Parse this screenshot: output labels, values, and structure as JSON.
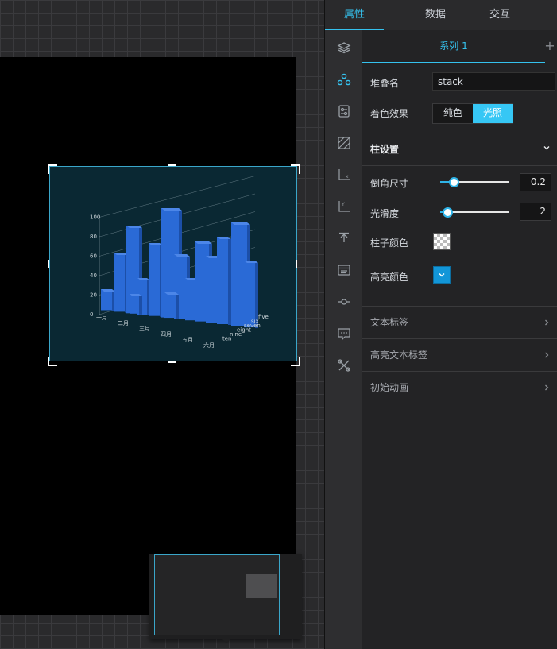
{
  "tabs": [
    {
      "label": "属性",
      "active": true
    },
    {
      "label": "数据",
      "active": false
    },
    {
      "label": "交互",
      "active": false
    }
  ],
  "iconbar": [
    "layers-icon",
    "series-icon",
    "component-settings-icon",
    "grid-icon",
    "x-axis-icon",
    "y-axis-icon",
    "upload-icon",
    "legend-icon",
    "slider-icon",
    "tooltip-icon",
    "tools-icon"
  ],
  "series_tab": {
    "label": "系列 1",
    "add": "+"
  },
  "stack": {
    "label": "堆叠名",
    "value": "stack"
  },
  "shading": {
    "label": "着色效果",
    "options": [
      "纯色",
      "光照"
    ],
    "selected": "光照"
  },
  "bar_settings": {
    "title": "柱设置",
    "bevel": {
      "label": "倒角尺寸",
      "value": "0.2",
      "ratio": 0.2
    },
    "smooth": {
      "label": "光滑度",
      "value": "2",
      "ratio": 0.1
    },
    "bar_color": {
      "label": "柱子颜色"
    },
    "highlight_color": {
      "label": "高亮颜色",
      "color": "#1296d8"
    }
  },
  "collapsed_sections": [
    "文本标签",
    "高亮文本标签",
    "初始动画"
  ],
  "chart": {
    "y_ticks": [
      "0",
      "20",
      "40",
      "60",
      "80",
      "100"
    ],
    "x_labels": [
      "一月",
      "二月",
      "三月",
      "四月",
      "五月",
      "六月"
    ],
    "z_labels": [
      "five",
      "six",
      "seven",
      "eight",
      "nine",
      "ten"
    ],
    "bar_color": "#2a6ad6"
  }
}
